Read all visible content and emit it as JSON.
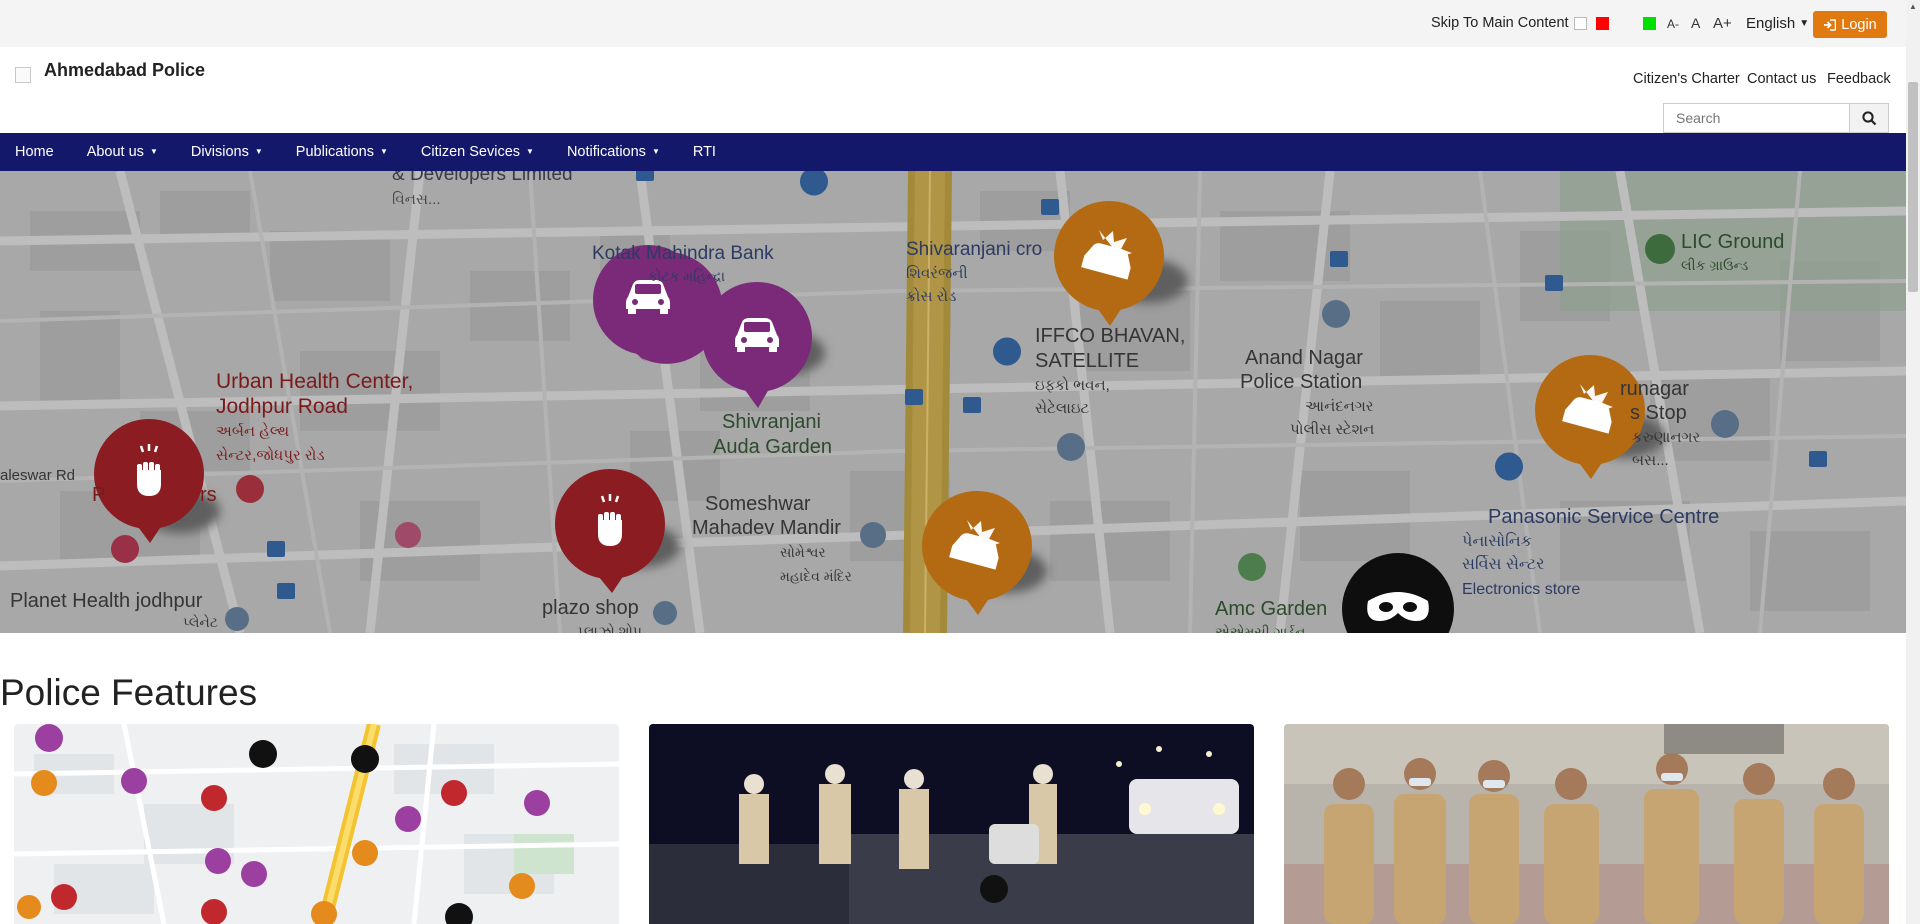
{
  "topbar": {
    "skip_label": "Skip To Main Content",
    "font_small": "A-",
    "font_normal": "A",
    "font_large": "A+",
    "language": "English",
    "login_label": "Login",
    "swatches": {
      "white": "#ffffff",
      "red": "#ff0000",
      "green": "#00e000"
    }
  },
  "header": {
    "site_name": "Ahmedabad Police",
    "links": [
      "Citizen's Charter",
      "Contact us",
      "Feedback"
    ],
    "search_placeholder": "Search"
  },
  "nav": {
    "items": [
      {
        "label": "Home",
        "dropdown": false
      },
      {
        "label": "About us",
        "dropdown": true
      },
      {
        "label": "Divisions",
        "dropdown": true
      },
      {
        "label": "Publications",
        "dropdown": true
      },
      {
        "label": "Citizen Sevices",
        "dropdown": true
      },
      {
        "label": "Notifications",
        "dropdown": true
      },
      {
        "label": "RTI",
        "dropdown": false
      }
    ],
    "color": "#14186a"
  },
  "banner": {
    "places": {
      "developers": "& Developers Limited",
      "developers_gu": "વિનસ...",
      "kotak": "Kotak Mahindra Bank",
      "kotak_gu": "કોટક મહિન્દ્રા",
      "shivaranjani_cross": "Shivaranjani cro",
      "shivaranjani_cross_gu": "શિવરંજની",
      "shivaranjani_cross_gu2": "ક્રોસ રોડ",
      "lic": "LIC Ground",
      "lic_gu": "લીક ગ્રાઉન્ડ",
      "urban_health_1": "Urban Health Center,",
      "urban_health_2": "Jodhpur Road",
      "urban_health_gu1": "અર્બન હેલ્થ",
      "urban_health_gu2": "સેન્ટર,જોધપુર રોડ",
      "iffco_1": "IFFCO BHAVAN,",
      "iffco_2": "SATELLITE",
      "iffco_gu1": "ઇફ્કો ભવન,",
      "iffco_gu2": "સેટેલાઇટ",
      "anand_1": "Anand Nagar",
      "anand_2": "Police Station",
      "anand_gu1": "આનંદનગર",
      "anand_gu2": "પોલીસ સ્ટેશન",
      "shivaranjani_garden_1": "Shivranjani",
      "shivaranjani_garden_2": "Auda Garden",
      "someshwar_1": "Someshwar",
      "someshwar_2": "Mahadev Mandir",
      "someshwar_gu1": "સોમેશ્વર",
      "someshwar_gu2": "મહાદેવ મંદિર",
      "busstop_1": "runagar",
      "busstop_2": "s Stop",
      "busstop_gu1": "કરુણાનગર",
      "busstop_gu2": "બસ...",
      "panasonic_1": "Panasonic Service Centre",
      "panasonic_gu1": "પેનાસોનિક",
      "panasonic_gu2": "સર્વિસ સેન્ટર",
      "panasonic_3": "Electronics store",
      "paleswar": "aleswar Rd",
      "pt": "P",
      "rs": "rs",
      "planet": "Planet Health jodhpur",
      "planet_gu": "પ્લેનેટ",
      "plazo": "plazo shop",
      "plazo_gu": "પ્લાઝો શોપ",
      "amc": "Amc Garden",
      "amc_gu": "એએમસી ગાર્ડન"
    }
  },
  "features": {
    "title": "Police Features",
    "cards": [
      {
        "name": "crime-map"
      },
      {
        "name": "night-checking"
      },
      {
        "name": "police-officers"
      }
    ]
  }
}
